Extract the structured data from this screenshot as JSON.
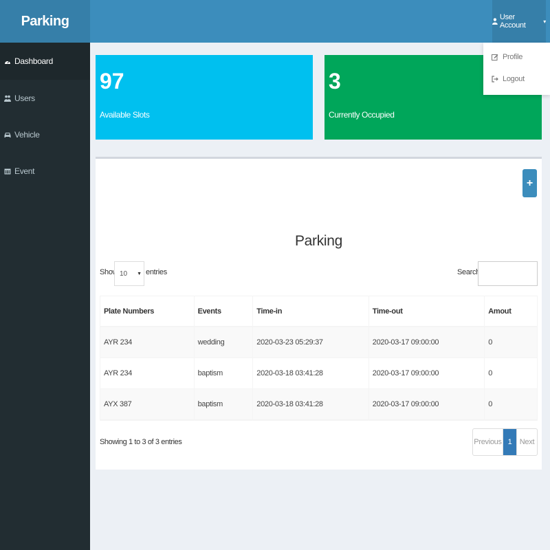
{
  "header": {
    "brand": "Parking",
    "user_account": "User Account",
    "caret": "▾"
  },
  "user_menu": {
    "items": [
      {
        "label": "Profile",
        "icon": "edit-icon"
      },
      {
        "label": "Logout",
        "icon": "sign-out-icon"
      }
    ]
  },
  "sidebar": {
    "items": [
      {
        "label": "Dashboard",
        "icon": "dashboard-icon",
        "active": true
      },
      {
        "label": "Users",
        "icon": "users-icon",
        "active": false
      },
      {
        "label": "Vehicle",
        "icon": "car-icon",
        "active": false
      },
      {
        "label": "Event",
        "icon": "calendar-icon",
        "active": false
      }
    ]
  },
  "stats": {
    "available": {
      "value": "97",
      "label": "Available Slots",
      "color": "#00c0ef"
    },
    "occupied": {
      "value": "3",
      "label": "Currently Occupied",
      "color": "#00a65a"
    }
  },
  "panel": {
    "add_button": "+",
    "title": "Parking",
    "show_label": "Show",
    "entries_value": "10",
    "entries_label": "entries",
    "search_label": "Search:",
    "search_value": ""
  },
  "table": {
    "columns": [
      "Plate Numbers",
      "Events",
      "Time-in",
      "Time-out",
      "Amout"
    ],
    "rows": [
      [
        "AYR 234",
        "wedding",
        "2020-03-23 05:29:37",
        "2020-03-17 09:00:00",
        "0"
      ],
      [
        "AYR 234",
        "baptism",
        "2020-03-18 03:41:28",
        "2020-03-17 09:00:00",
        "0"
      ],
      [
        "AYX 387",
        "baptism",
        "2020-03-18 03:41:28",
        "2020-03-17 09:00:00",
        "0"
      ]
    ]
  },
  "footer": {
    "info": "Showing 1 to 3 of 3 entries",
    "previous": "Previous",
    "current_page": "1",
    "next": "Next"
  },
  "colors": {
    "header": "#3c8dbc",
    "sidebar": "#222d32",
    "primary": "#337ab7"
  }
}
